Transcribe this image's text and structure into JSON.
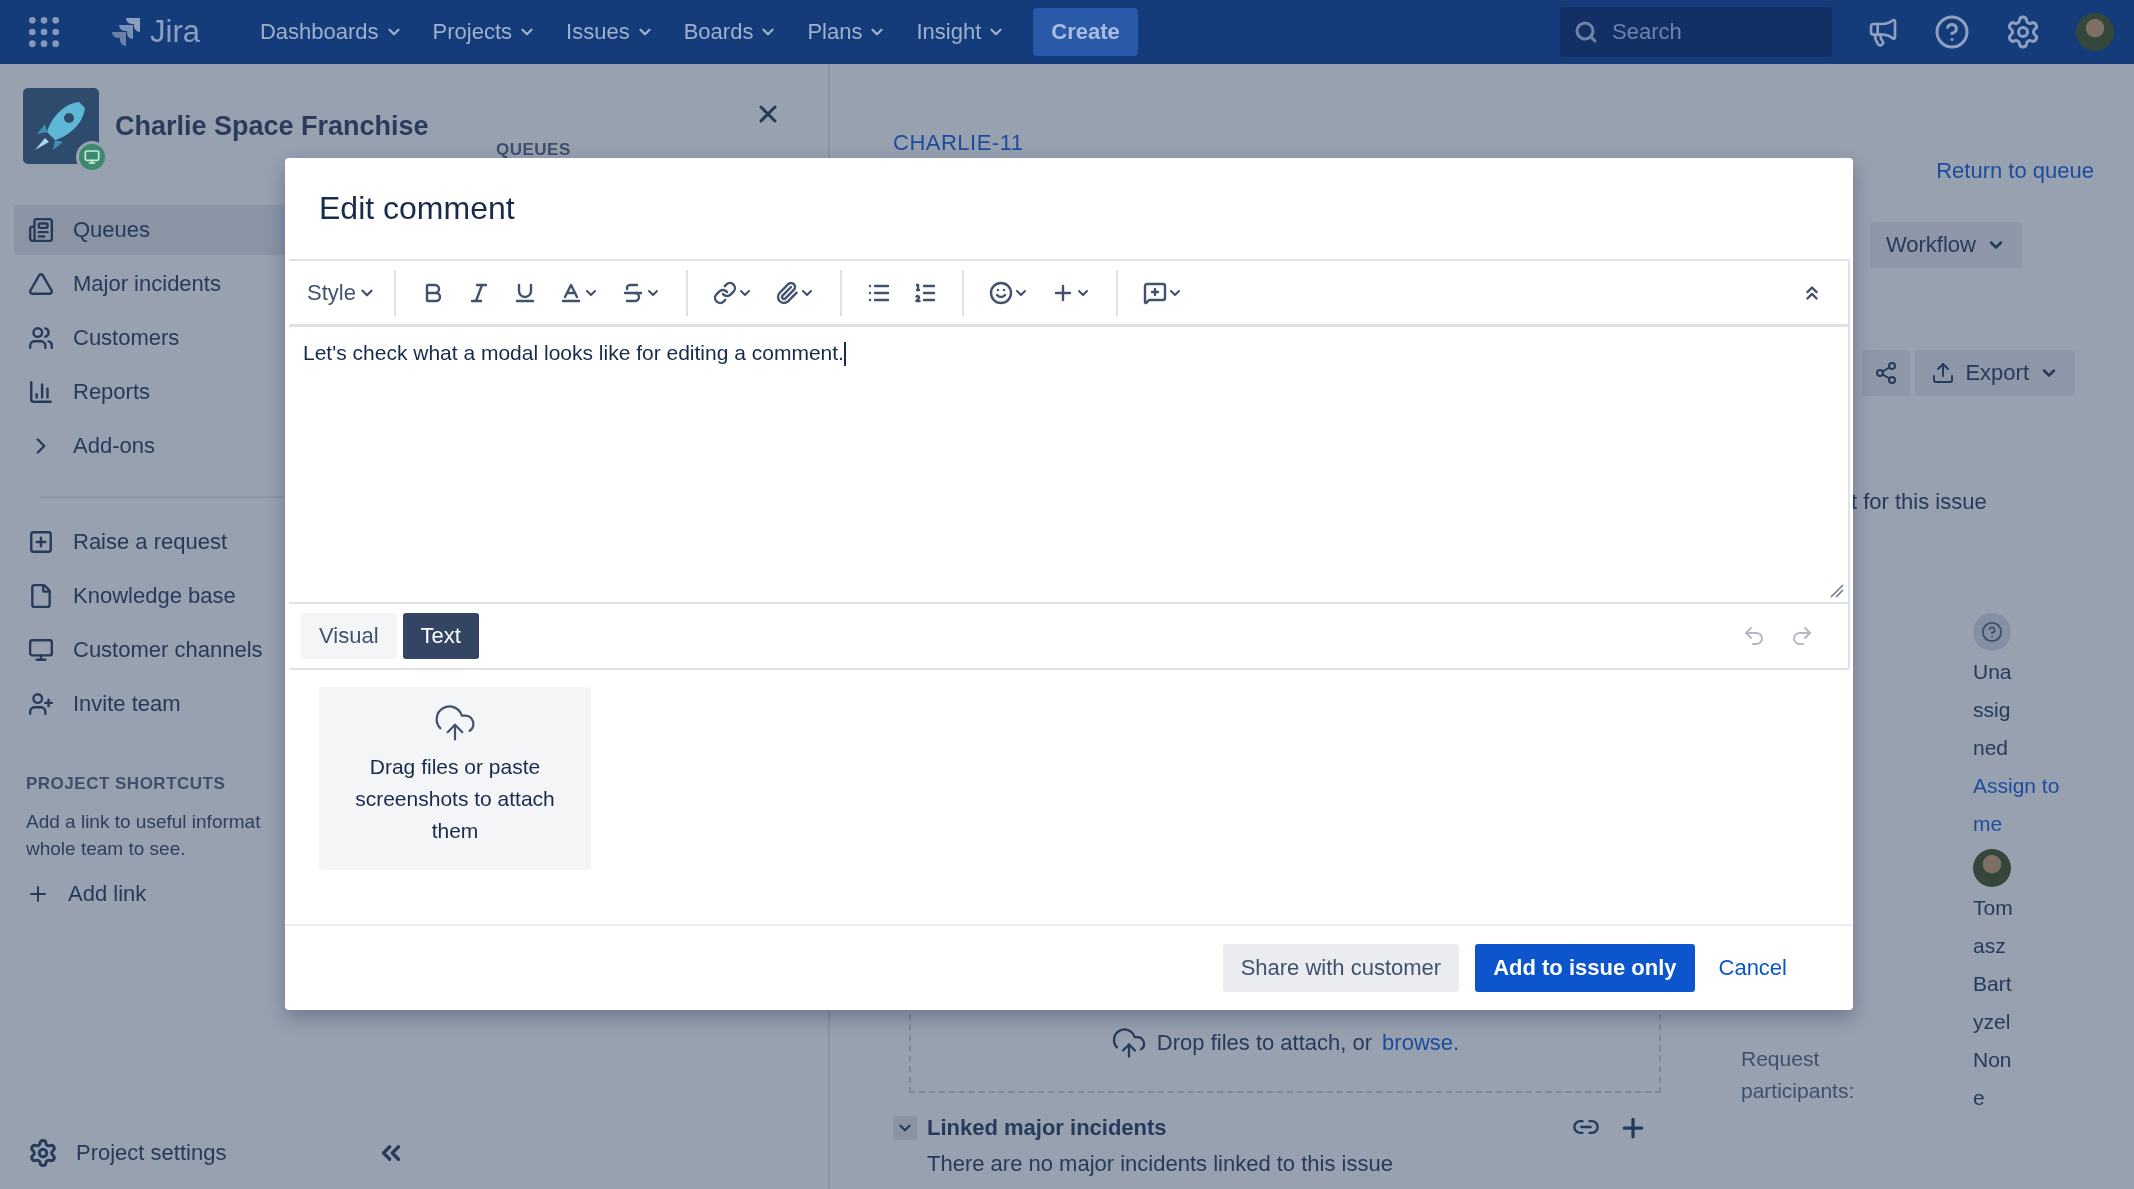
{
  "nav": {
    "logo_text": "Jira",
    "items": [
      {
        "label": "Dashboards"
      },
      {
        "label": "Projects"
      },
      {
        "label": "Issues"
      },
      {
        "label": "Boards"
      },
      {
        "label": "Plans"
      },
      {
        "label": "Insight"
      }
    ],
    "create": "Create",
    "search": {
      "placeholder": "Search"
    }
  },
  "sidebar": {
    "project": "Charlie Space Franchise",
    "items": [
      {
        "label": "Queues",
        "kind": "queues",
        "selected": true
      },
      {
        "label": "Major incidents",
        "kind": "incidents",
        "selected": false
      },
      {
        "label": "Customers",
        "kind": "customers",
        "selected": false
      },
      {
        "label": "Reports",
        "kind": "reports",
        "selected": false
      },
      {
        "label": "Add-ons",
        "kind": "group",
        "selected": false
      }
    ],
    "secondary": [
      {
        "label": "Raise a request",
        "kind": "raise"
      },
      {
        "label": "Knowledge base",
        "kind": "knowledge"
      },
      {
        "label": "Customer channels",
        "kind": "channels"
      },
      {
        "label": "Invite team",
        "kind": "invite"
      }
    ],
    "shortcuts": {
      "heading": "PROJECT SHORTCUTS",
      "text": "Add a link to useful informat\nwhole team to see.",
      "add_link": "Add link"
    },
    "settings": "Project settings"
  },
  "queue_panel": {
    "heading": "QUEUES"
  },
  "issue": {
    "key": "CHARLIE-11",
    "return_link": "Return to queue",
    "workflow": "Workflow",
    "export": "Export",
    "partial_text": "t for this issue",
    "assignee": {
      "name": "Unassigned",
      "assign_link": "Assign to me"
    },
    "reporter": {
      "name": "Tomasz Bartyzel"
    },
    "participants": {
      "label": "Request participants:",
      "value": "None"
    },
    "drop_zone": {
      "text": "Drop files to attach, or ",
      "link": "browse."
    },
    "linked": {
      "title": "Linked major incidents",
      "expanded": true,
      "empty_text": "There are no major incidents linked to this issue"
    }
  },
  "modal": {
    "title": "Edit comment",
    "style_label": "Style",
    "body": "Let's check what a modal looks like for editing a comment.",
    "tabs": [
      {
        "label": "Visual",
        "selected": false
      },
      {
        "label": "Text",
        "selected": true
      }
    ],
    "undo": {
      "disabled": true
    },
    "redo": {
      "disabled": true
    },
    "attach_text": "Drag files or paste screenshots to attach them",
    "buttons": [
      {
        "label": "Share with customer",
        "kind": "secondary"
      },
      {
        "label": "Add to issue only",
        "kind": "primary"
      },
      {
        "label": "Cancel",
        "kind": "link"
      }
    ]
  }
}
